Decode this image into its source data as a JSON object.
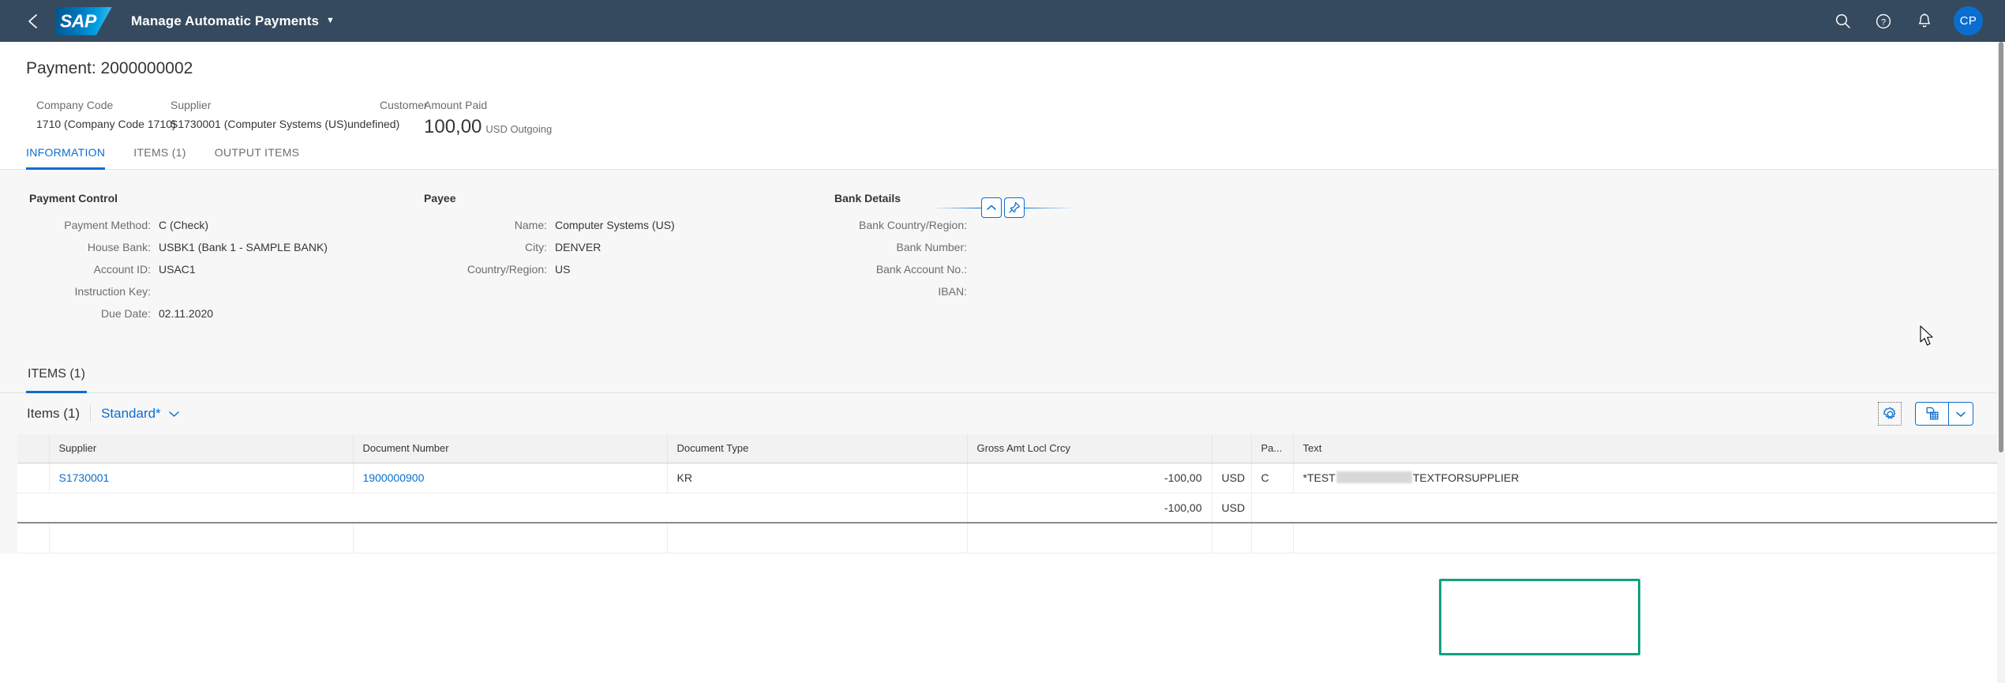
{
  "shell": {
    "back_icon": "chevron-left-icon",
    "logo_text": "SAP",
    "app_title": "Manage Automatic Payments",
    "title_caret": "▼",
    "icons": [
      "search-icon",
      "help-icon",
      "bell-icon"
    ],
    "avatar_initials": "CP"
  },
  "header": {
    "title": "Payment: 2000000002",
    "facts": [
      {
        "label": "Company Code",
        "value": "1710 (Company Code 1710)"
      },
      {
        "label": "Supplier",
        "value": "S1730001 (Computer Systems (US)undefined)"
      },
      {
        "label": "Customer",
        "value": ""
      }
    ],
    "amount": {
      "label": "Amount Paid",
      "value": "100,00",
      "unit": "USD Outgoing"
    },
    "collapse_icon": "chevron-up-icon",
    "pin_icon": "pin-icon"
  },
  "tabs": [
    {
      "label": "INFORMATION",
      "active": true
    },
    {
      "label": "ITEMS (1)",
      "active": false
    },
    {
      "label": "OUTPUT ITEMS",
      "active": false
    }
  ],
  "form": {
    "payment_control": {
      "title": "Payment Control",
      "rows": [
        {
          "label": "Payment Method:",
          "value": "C (Check)"
        },
        {
          "label": "House Bank:",
          "value": "USBK1 (Bank 1 - SAMPLE BANK)"
        },
        {
          "label": "Account ID:",
          "value": "USAC1"
        },
        {
          "label": "Instruction Key:",
          "value": ""
        },
        {
          "label": "Due Date:",
          "value": "02.11.2020"
        }
      ]
    },
    "payee": {
      "title": "Payee",
      "rows": [
        {
          "label": "Name:",
          "value": "Computer Systems (US)"
        },
        {
          "label": "City:",
          "value": "DENVER"
        },
        {
          "label": "Country/Region:",
          "value": "US"
        }
      ]
    },
    "bank_details": {
      "title": "Bank Details",
      "rows": [
        {
          "label": "Bank Country/Region:",
          "value": ""
        },
        {
          "label": "Bank Number:",
          "value": ""
        },
        {
          "label": "Bank Account No.:",
          "value": ""
        },
        {
          "label": "IBAN:",
          "value": ""
        }
      ]
    }
  },
  "items_section": {
    "anchor_label": "ITEMS (1)",
    "toolbar": {
      "title": "Items (1)",
      "variant": "Standard*",
      "variant_caret": "chevron-down-icon",
      "settings_icon": "gear-icon",
      "export_icon": "spreadsheet-export-icon",
      "export_caret_icon": "chevron-down-icon"
    },
    "columns": [
      {
        "key": "supplier",
        "label": "Supplier",
        "align": "left"
      },
      {
        "key": "document_number",
        "label": "Document Number",
        "align": "left"
      },
      {
        "key": "document_type",
        "label": "Document Type",
        "align": "left"
      },
      {
        "key": "gross_amt",
        "label": "Gross Amt Locl Crcy",
        "align": "right"
      },
      {
        "key": "currency",
        "label": "",
        "align": "left"
      },
      {
        "key": "pa",
        "label": "Pa...",
        "align": "left"
      },
      {
        "key": "text",
        "label": "Text",
        "align": "left"
      }
    ],
    "rows": [
      {
        "supplier": "S1730001",
        "document_number": "1900000900",
        "document_type": "KR",
        "gross_amt": "-100,00",
        "currency": "USD",
        "pa": "C",
        "text_prefix": "*TEST",
        "text_redacted": true,
        "text_suffix": "TEXTFORSUPPLIER"
      }
    ],
    "total_row": {
      "gross_amt": "-100,00",
      "currency": "USD"
    },
    "highlight_color": "#12a27f"
  },
  "colors": {
    "shell_bg": "#354a5f",
    "accent": "#0a6ed1",
    "page_bg": "#f7f7f7",
    "text": "#32363a",
    "label": "#6a6d70",
    "highlight": "#12a27f"
  }
}
